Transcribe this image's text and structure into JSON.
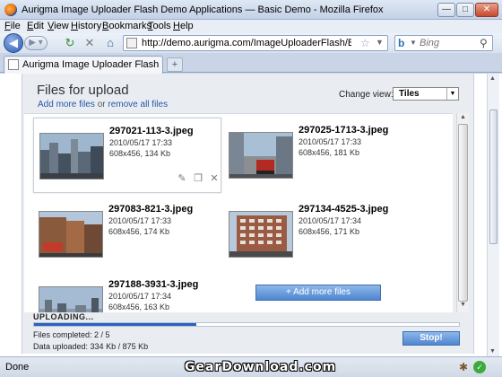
{
  "window": {
    "title": "Aurigma Image Uploader Flash Demo Applications — Basic Demo - Mozilla Firefox",
    "min_label": "—",
    "max_label": "□",
    "close_label": "✕"
  },
  "menu": [
    {
      "label": "File",
      "accel": "F",
      "rest": "ile"
    },
    {
      "label": "Edit",
      "accel": "E",
      "rest": "dit"
    },
    {
      "label": "View",
      "accel": "V",
      "rest": "iew"
    },
    {
      "label": "History",
      "accel": "H",
      "rest": "istory"
    },
    {
      "label": "Bookmarks",
      "accel": "B",
      "rest": "ookmarks"
    },
    {
      "label": "Tools",
      "accel": "T",
      "rest": "ools"
    },
    {
      "label": "Help",
      "accel": "H",
      "rest": "elp"
    }
  ],
  "nav": {
    "url": "http://demo.aurigma.com/ImageUploaderFlash/BasicDemo/simple",
    "search_placeholder": "Bing",
    "icons": {
      "back": "back-arrow-icon",
      "forward": "forward-arrow-icon",
      "reload": "reload-icon",
      "stop": "stop-icon",
      "home": "home-icon"
    }
  },
  "tab": {
    "label": "Aurigma Image Uploader Flash Demo...",
    "new_tab": "+"
  },
  "uploader": {
    "title": "Files for upload",
    "link_add": "Add more files",
    "link_or": "or",
    "link_remove": "remove all files",
    "change_view_label": "Change view:",
    "view_value": "Tiles",
    "add_more_button": "+ Add more files",
    "files": [
      {
        "name": "297021-113-3.jpeg",
        "date": "2010/05/17 17:33",
        "info": "608x456, 134 Kb"
      },
      {
        "name": "297025-1713-3.jpeg",
        "date": "2010/05/17 17:33",
        "info": "608x456, 181 Kb"
      },
      {
        "name": "297083-821-3.jpeg",
        "date": "2010/05/17 17:33",
        "info": "608x456, 174 Kb"
      },
      {
        "name": "297134-4525-3.jpeg",
        "date": "2010/05/17 17:34",
        "info": "608x456, 171 Kb"
      },
      {
        "name": "297188-3931-3.jpeg",
        "date": "2010/05/17 17:34",
        "info": "608x456, 163 Kb"
      }
    ],
    "uploading_label": "UPLOADING...",
    "progress_fraction": 0.382,
    "files_completed": "Files completed: 2 / 5",
    "data_uploaded": "Data uploaded: 334 Kb / 875 Kb",
    "stop_button": "Stop!"
  },
  "status": {
    "text": "Done",
    "watermark": "GearDownload.com"
  },
  "colors": {
    "accent": "#4f86d0",
    "progress": "#2b61c2",
    "link": "#2a56a8"
  }
}
